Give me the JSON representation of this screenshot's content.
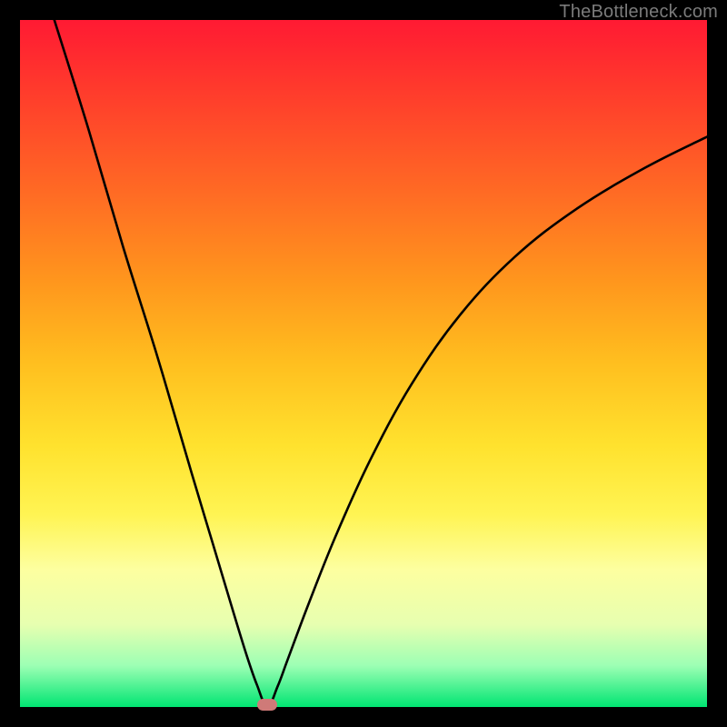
{
  "attribution": "TheBottleneck.com",
  "colors": {
    "frame": "#000000",
    "gradient_top": "#ff1a33",
    "gradient_bottom": "#00e572",
    "curve": "#000000",
    "min_marker": "#cf7a78",
    "attribution_text": "#7b7b7b"
  },
  "chart_data": {
    "type": "line",
    "title": "",
    "xlabel": "",
    "ylabel": "",
    "xlim": [
      0,
      100
    ],
    "ylim": [
      0,
      100
    ],
    "grid": false,
    "legend": false,
    "annotations": [
      {
        "kind": "minimum_marker",
        "x": 36,
        "y": 0
      }
    ],
    "series": [
      {
        "name": "bottleneck-curve",
        "x": [
          5,
          10,
          15,
          20,
          25,
          28,
          31,
          33,
          34.5,
          36,
          37.5,
          39,
          42,
          46,
          51,
          57,
          64,
          72,
          81,
          91,
          100
        ],
        "values": [
          100,
          84,
          67,
          51,
          34,
          24,
          14,
          7.5,
          3.2,
          0,
          3.0,
          7.0,
          15,
          25,
          36,
          47,
          57,
          65.5,
          72.5,
          78.5,
          83
        ]
      }
    ]
  }
}
